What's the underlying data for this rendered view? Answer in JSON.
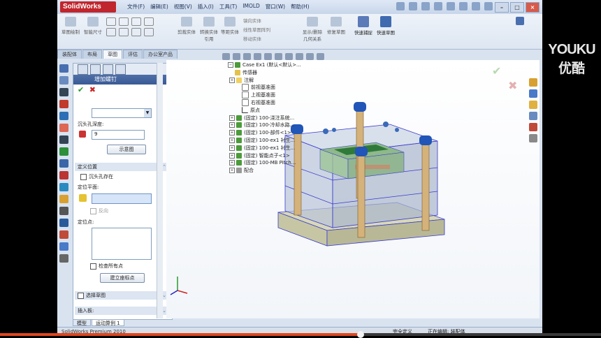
{
  "app": {
    "logo": "SolidWorks",
    "version_text": "SolidWorks Premium 2010"
  },
  "menu": [
    "文件(F)",
    "编辑(E)",
    "视图(V)",
    "插入(I)",
    "工具(T)",
    "IMOLD",
    "窗口(W)",
    "帮助(H)"
  ],
  "ribbon": {
    "buttons": [
      "草图绘制",
      "智能尺寸"
    ],
    "groups": [
      "剪裁实体",
      "转换实体引用",
      "等距实体"
    ],
    "list": [
      "镜向实体",
      "线性草图阵列",
      "移动实体"
    ],
    "more": [
      "显示/删除几何关系",
      "修复草图"
    ],
    "quick": [
      "快速捕捉",
      "快速草图"
    ]
  },
  "tabs": [
    "装配体",
    "布局",
    "草图",
    "评估",
    "办公室产品"
  ],
  "active_tab_index": 2,
  "pm": {
    "title": "增加螺钉",
    "help": "?",
    "ok": "✔",
    "cancel": "✖",
    "depth_label": "沉头孔深度:",
    "depth_value": "9",
    "show_button": "示意图",
    "section_title": "定义位置",
    "countersink_label": "沉头孔存在",
    "plane_label": "定位平面:",
    "reverse_label": "反向",
    "points_label": "定位点:",
    "check_label": "检查所有点",
    "create_button": "建立座标点",
    "select_sketch": "选择草图",
    "insert_label": "插入板:"
  },
  "tree": {
    "root": "Case Ex1  (默认<默认>...",
    "items": [
      "传感器",
      "注解",
      "前视基准面",
      "上视基准面",
      "右视基准面",
      "原点",
      "(固定) 100-浇注系统...",
      "(固定) 100-冷却水路...",
      "(固定) 100-部件<1>",
      "(固定) 100-ex1 衬生...",
      "(固定) 100-ex1 衬生...",
      "(固定) 智能点子<1>",
      "(固定) 100-MB Pitch...",
      "配合"
    ]
  },
  "bottom_tabs": [
    "模型",
    "运动算例 1"
  ],
  "status": {
    "s1": "完全定义",
    "s2": "正在编辑: 装配体"
  },
  "watermark": {
    "en": "YOUKU",
    "cn": "优酷"
  },
  "video_progress": 0.6
}
